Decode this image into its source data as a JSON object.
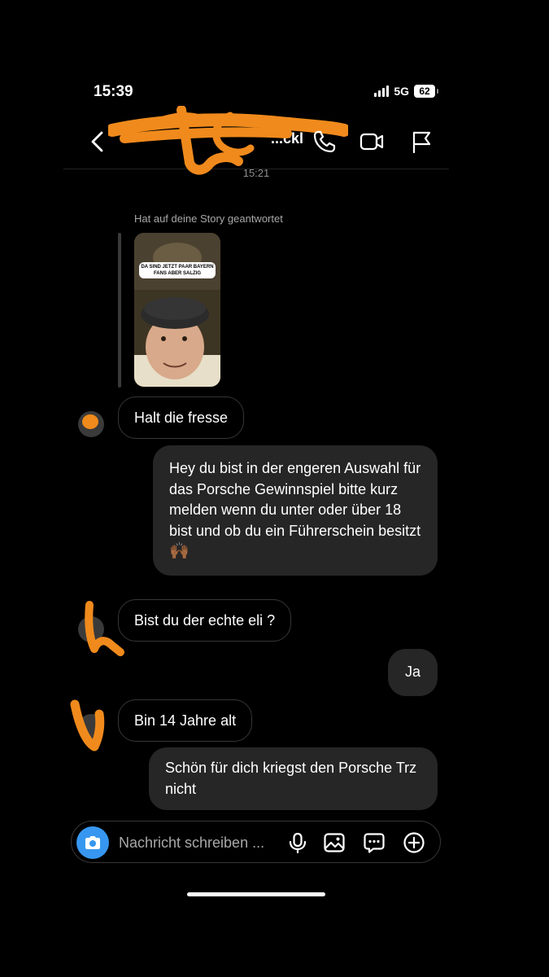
{
  "status_bar": {
    "time": "15:39",
    "network": "5G",
    "battery": "62"
  },
  "header": {
    "contact_name": "...ckl"
  },
  "thread": {
    "timestamp": "15:21",
    "story_reply_caption": "Hat auf deine Story geantwortet",
    "story_overlay_text": "DA SIND JETZT PAAR BAYERN FANS ABER SALZIG"
  },
  "messages": [
    {
      "sender": "them",
      "text": "Halt die fresse"
    },
    {
      "sender": "me",
      "text": "Hey du bist in der engeren Auswahl für das Porsche Gewinnspiel bitte kurz melden wenn du unter oder über 18 bist und ob du ein Führerschein besitzt",
      "emoji": "🙌🏾"
    },
    {
      "sender": "them",
      "text": "Bist du der echte eli ?"
    },
    {
      "sender": "me",
      "text": "Ja"
    },
    {
      "sender": "them",
      "text": "Bin 14 Jahre alt"
    },
    {
      "sender": "me",
      "text": "Schön für dich kriegst den Porsche Trz nicht"
    }
  ],
  "composer": {
    "placeholder": "Nachricht schreiben ..."
  },
  "colors": {
    "accent": "#3797f0",
    "scribble": "#f08a1c",
    "bubble_out": "#262626"
  }
}
